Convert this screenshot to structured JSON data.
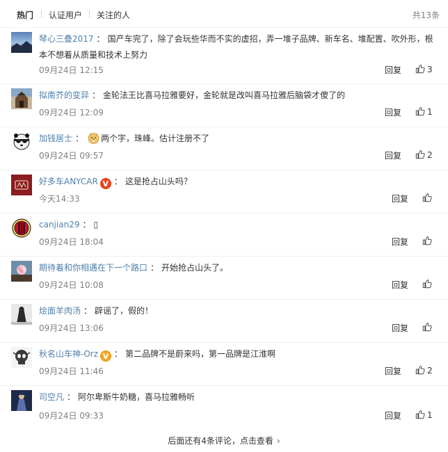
{
  "tabs": {
    "hot": "热门",
    "verified": "认证用户",
    "following": "关注的人",
    "total": "共13条"
  },
  "comments": [
    {
      "user": "琴心三叠2017",
      "colon": "：",
      "text": "国产车完了，除了会玩些华而不实的虚招，弄一堆子品牌、新车名、堆配置、吹外形，根本不想着从质量和技术上努力",
      "time": "09月24日 12:15",
      "reply": "回复",
      "likes": "3",
      "avatar": "sunset-avatar"
    },
    {
      "user": "拟南芥的变异",
      "colon": "：",
      "text": "金轮法王比喜马拉雅要好，金轮就是改叫喜马拉雅后脑袋才傻了的",
      "time": "09月24日 12:09",
      "reply": "回复",
      "likes": "1",
      "avatar": "tower-avatar"
    },
    {
      "user": "加钱居士",
      "colon": "：",
      "text": "两个字，珠峰。估计注册不了",
      "time": "09月24日 09:57",
      "reply": "回复",
      "likes": "2",
      "avatar": "panda-avatar",
      "emoji": "doge"
    },
    {
      "user": "好多车ANYCAR",
      "colon": "：",
      "text": "这是抢占山头吗？",
      "time": "今天14:33",
      "reply": "回复",
      "likes": "",
      "avatar": "anycar-avatar",
      "badge": "V"
    },
    {
      "user": "canjian29",
      "colon": "：",
      "text": "",
      "time": "09月24日 18:04",
      "reply": "回复",
      "likes": "",
      "avatar": "acmilan-avatar",
      "glyph": "▯"
    },
    {
      "user": "期待着和你相遇在下一个路口",
      "colon": "：",
      "text": "开始抢占山头了。",
      "time": "09月24日 10:08",
      "reply": "回复",
      "likes": "",
      "avatar": "flower-avatar"
    },
    {
      "user": "烩面羊肉汤",
      "colon": "：",
      "text": "辟谣了，假的！",
      "time": "09月24日 13:06",
      "reply": "回复",
      "likes": "",
      "avatar": "figure-avatar"
    },
    {
      "user": "秋名山车神-Orz",
      "colon": "：",
      "text": "第二品牌不是蔚来吗，第一品牌是江淮啊",
      "time": "09月24日 11:46",
      "reply": "回复",
      "likes": "2",
      "avatar": "skull-avatar",
      "badge": "V"
    },
    {
      "user": "司空凡",
      "colon": "：",
      "text": "阿尔卑斯牛奶糖，喜马拉雅畅听",
      "time": "09月24日 09:33",
      "reply": "回复",
      "likes": "1",
      "avatar": "hero-avatar"
    }
  ],
  "more": "后面还有4条评论，点击查看"
}
